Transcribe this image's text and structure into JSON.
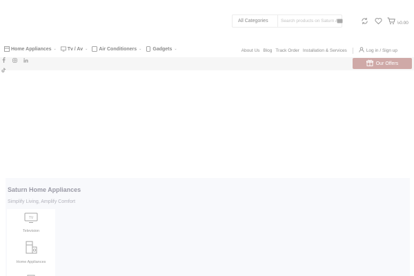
{
  "header": {
    "category_select": "All Categories",
    "search_placeholder": "Search products on Saturn App...",
    "cart_total": "৳0.00"
  },
  "nav": {
    "items": [
      {
        "label": "Home Appliances"
      },
      {
        "label": "Tv / Av"
      },
      {
        "label": "Air Conditioners"
      },
      {
        "label": "Gadgets"
      }
    ],
    "links": [
      "About Us",
      "Blog",
      "Track Order",
      "Installation & Services"
    ],
    "login": "Log in / Sign up"
  },
  "strip": {
    "offers_label": "Our Offers"
  },
  "hero": {
    "brand_title": "Saturn Home Appliances",
    "brand_tagline": "Simplify Living, Amplify Comfort",
    "categories": [
      {
        "label": "Television"
      },
      {
        "label": "Home Appliances"
      }
    ]
  },
  "colors": {
    "offers_bg": "#cfa9a7",
    "hero_bg": "#f8f9fc",
    "strip_bg": "#f6f6f6"
  }
}
